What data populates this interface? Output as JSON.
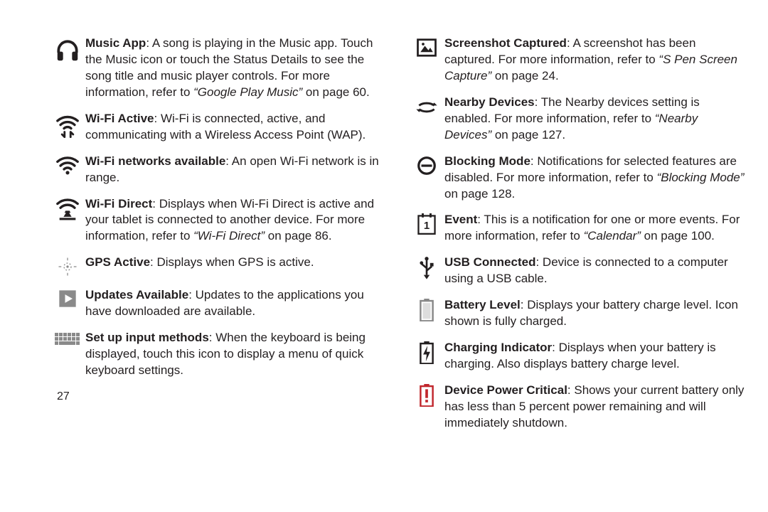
{
  "page_number": "27",
  "left": [
    {
      "title": "Music App",
      "body": ": A song is playing in the Music app. Touch the Music icon or touch the Status Details to see the song title and music player controls. For more information, refer to ",
      "ref": "“Google Play Music”",
      "tail": " on page 60."
    },
    {
      "title": "Wi-Fi Active",
      "body": ": Wi-Fi is connected, active, and communicating with a Wireless Access Point (WAP).",
      "ref": "",
      "tail": ""
    },
    {
      "title": "Wi-Fi networks available",
      "body": ": An open Wi-Fi network is in range.",
      "ref": "",
      "tail": ""
    },
    {
      "title": "Wi-Fi Direct",
      "body": ": Displays when Wi-Fi Direct is active and your tablet is connected to another device. For more information, refer to ",
      "ref": "“Wi-Fi Direct”",
      "tail": " on page 86."
    },
    {
      "title": "GPS Active",
      "body": ": Displays when GPS is active.",
      "ref": "",
      "tail": ""
    },
    {
      "title": "Updates Available",
      "body": ": Updates to the applications you have downloaded are available.",
      "ref": "",
      "tail": ""
    },
    {
      "title": "Set up input methods",
      "body": ": When the keyboard is being displayed, touch this icon to display a menu of quick keyboard settings.",
      "ref": "",
      "tail": ""
    }
  ],
  "right": [
    {
      "title": "Screenshot Captured",
      "body": ": A screenshot has been captured. For more information, refer to ",
      "ref": "“S Pen Screen Capture”",
      "tail": " on page 24."
    },
    {
      "title": "Nearby Devices",
      "body": ": The Nearby devices setting is enabled. For more information, refer to ",
      "ref": "“Nearby Devices”",
      "tail": " on page 127."
    },
    {
      "title": "Blocking Mode",
      "body": ": Notifications for selected features are disabled. For more information, refer to ",
      "ref": "“Blocking Mode”",
      "tail": " on page 128."
    },
    {
      "title": "Event",
      "body": ": This is a notification for one or more events. For more information, refer to ",
      "ref": "“Calendar”",
      "tail": " on page 100."
    },
    {
      "title": "USB Connected",
      "body": ": Device is connected to a computer using a USB cable.",
      "ref": "",
      "tail": ""
    },
    {
      "title": "Battery Level",
      "body": ": Displays your battery charge level. Icon shown is fully charged.",
      "ref": "",
      "tail": ""
    },
    {
      "title": "Charging Indicator",
      "body": ": Displays when your battery is charging. Also displays battery charge level.",
      "ref": "",
      "tail": ""
    },
    {
      "title": "Device Power Critical",
      "body": ": Shows your current battery only has less than 5 percent power remaining and will immediately shutdown.",
      "ref": "",
      "tail": ""
    }
  ]
}
